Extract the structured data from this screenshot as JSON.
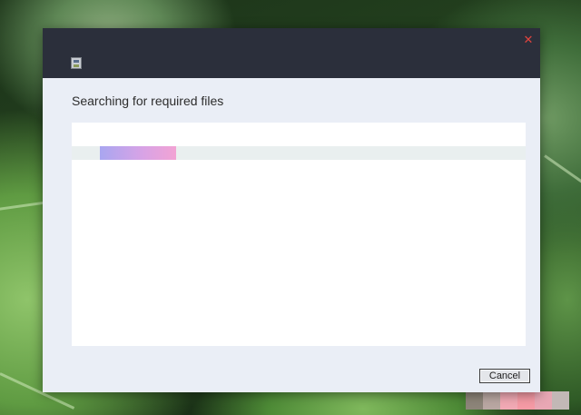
{
  "window": {
    "app_icon": "setup-app-icon",
    "close_icon": "close-icon",
    "close_glyph": "✕"
  },
  "main": {
    "heading": "Searching for required files",
    "progress": {
      "state": "indeterminate",
      "gradient_colors": [
        "#a9a6f0",
        "#f2a3d4"
      ]
    }
  },
  "footer": {
    "cancel_label": "Cancel"
  },
  "colors": {
    "titlebar": "#2b2f3b",
    "dialog_body": "#eaeef6",
    "panel": "#ffffff",
    "close_icon": "#e0443e"
  }
}
